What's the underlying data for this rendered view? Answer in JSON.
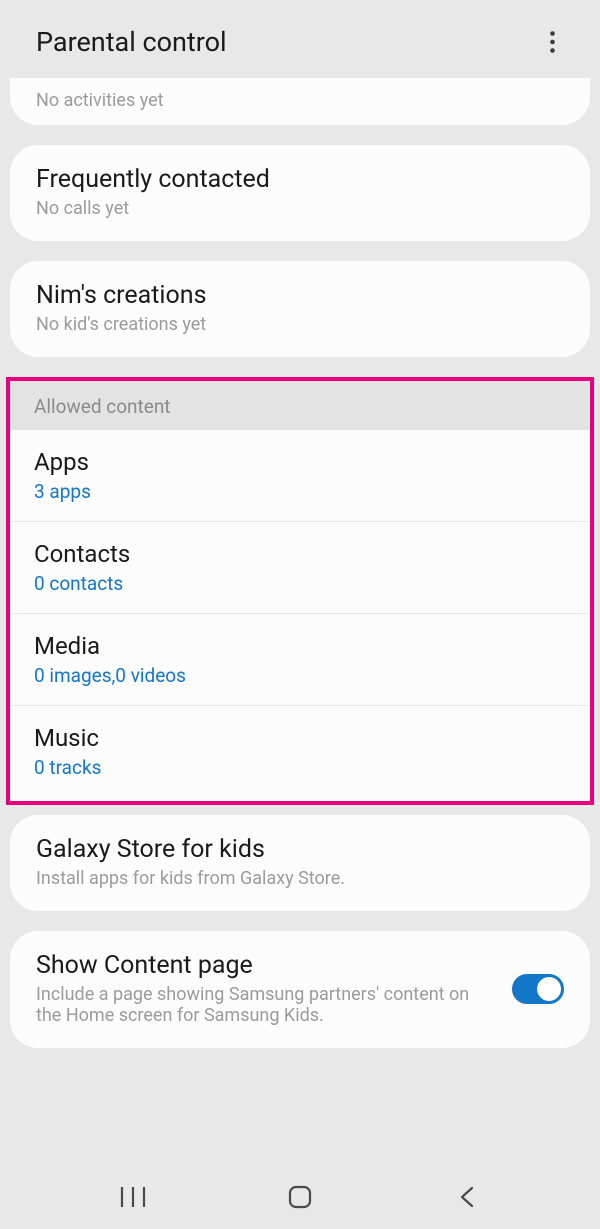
{
  "header": {
    "title": "Parental control"
  },
  "activities": {
    "subtitle": "No activities yet"
  },
  "frequently": {
    "title": "Frequently contacted",
    "subtitle": "No calls yet"
  },
  "creations": {
    "title": "Nim's creations",
    "subtitle": "No kid's creations yet"
  },
  "allowed": {
    "header": "Allowed content",
    "items": [
      {
        "title": "Apps",
        "subtitle": "3 apps"
      },
      {
        "title": "Contacts",
        "subtitle": "0 contacts"
      },
      {
        "title": "Media",
        "subtitle": "0 images,0 videos"
      },
      {
        "title": "Music",
        "subtitle": "0 tracks"
      }
    ]
  },
  "galaxy_store": {
    "title": "Galaxy Store for kids",
    "subtitle": "Install apps for kids from Galaxy Store."
  },
  "content_page": {
    "title": "Show Content page",
    "subtitle": "Include a page showing Samsung partners' content on the Home screen for Samsung Kids.",
    "toggle_on": true
  }
}
